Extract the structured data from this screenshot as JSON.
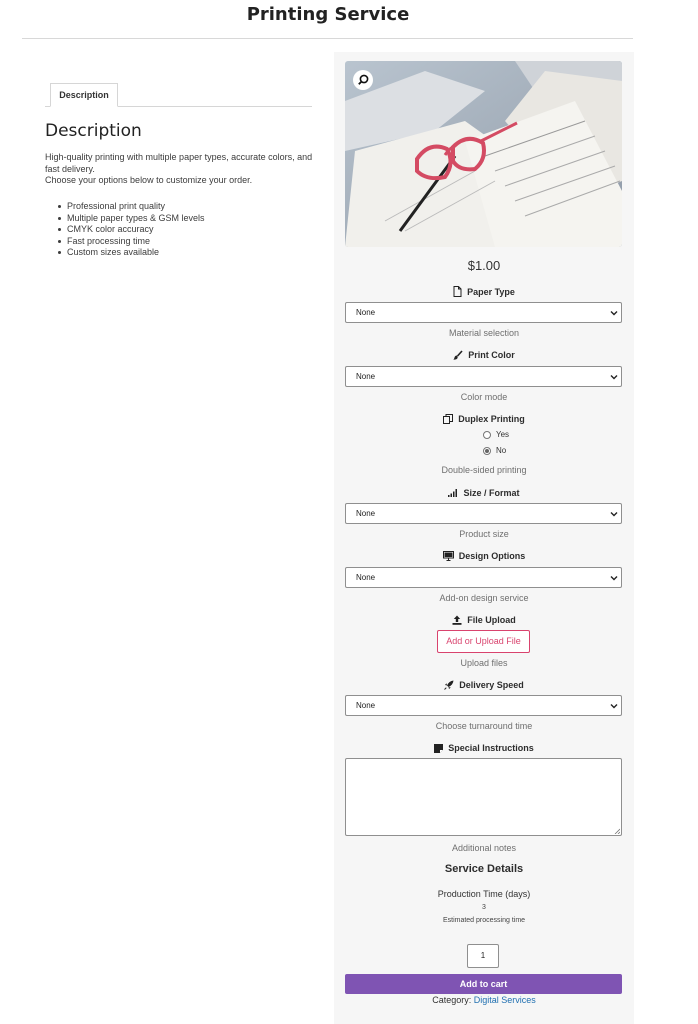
{
  "page": {
    "title": "Printing Service"
  },
  "tabs": [
    {
      "label": "Description"
    }
  ],
  "description": {
    "heading": "Description",
    "lines": [
      "High-quality printing with multiple paper types, accurate colors, and fast delivery.",
      "Choose your options below to customize your order."
    ],
    "features": [
      "Professional print quality",
      "Multiple paper types & GSM levels",
      "CMYK color accuracy",
      "Fast processing time",
      "Custom sizes available"
    ]
  },
  "product": {
    "price": "$1.00",
    "image_icon": "magnifier-icon"
  },
  "fields": {
    "paper_type": {
      "label": "Paper Type",
      "icon": "file-icon",
      "selected": "None",
      "help": "Material selection"
    },
    "print_color": {
      "label": "Print Color",
      "icon": "paintbrush-icon",
      "selected": "None",
      "help": "Color mode"
    },
    "duplex": {
      "label": "Duplex Printing",
      "icon": "duplicate-icon",
      "options": [
        "Yes",
        "No"
      ],
      "selected": "No",
      "help": "Double-sided printing"
    },
    "size": {
      "label": "Size / Format",
      "icon": "signal-bars-icon",
      "selected": "None",
      "help": "Product size"
    },
    "design": {
      "label": "Design Options",
      "icon": "monitor-icon",
      "selected": "None",
      "help": "Add-on design service"
    },
    "upload": {
      "label": "File Upload",
      "icon": "upload-icon",
      "button": "Add or Upload File",
      "help": "Upload files"
    },
    "delivery": {
      "label": "Delivery Speed",
      "icon": "rocket-icon",
      "selected": "None",
      "help": "Choose turnaround time"
    },
    "instructions": {
      "label": "Special Instructions",
      "icon": "note-icon",
      "value": "",
      "help": "Additional notes"
    }
  },
  "service_details": {
    "title": "Service Details",
    "production_label": "Production Time (days)",
    "production_value": "3",
    "production_help": "Estimated processing time"
  },
  "cart": {
    "quantity": "1",
    "button": "Add to cart",
    "category_label": "Category:",
    "category_link": "Digital Services"
  },
  "colors": {
    "accent": "#7f54b3",
    "upload_border": "#d9436e",
    "link": "#2271b1"
  }
}
